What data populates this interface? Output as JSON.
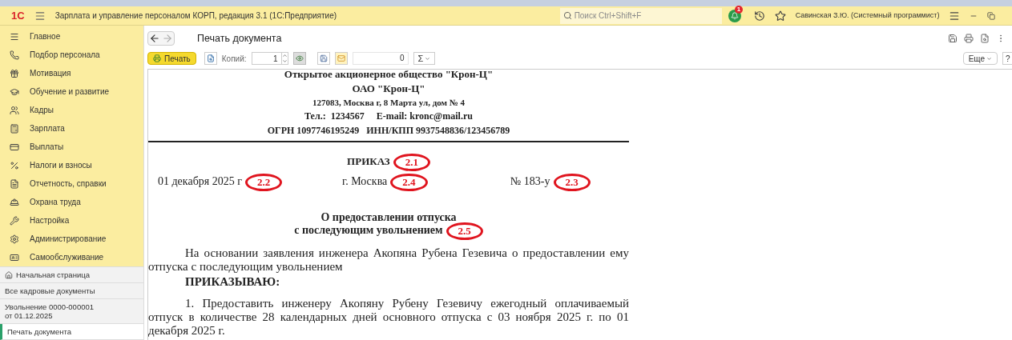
{
  "app_bar": {
    "logo": "1С",
    "title": "Зарплата и управление персоналом КОРП, редакция 3.1  (1С:Предприятие)",
    "search": {
      "placeholder": "Поиск Ctrl+Shift+F"
    },
    "notifications": "1",
    "user": "Савинская З.Ю. (Системный программист)"
  },
  "sections": [
    {
      "label": "Главное"
    },
    {
      "label": "Подбор персонала"
    },
    {
      "label": "Мотивация"
    },
    {
      "label": "Обучение и развитие"
    },
    {
      "label": "Кадры"
    },
    {
      "label": "Зарплата"
    },
    {
      "label": "Выплаты"
    },
    {
      "label": "Налоги и взносы"
    },
    {
      "label": "Отчетность, справки"
    },
    {
      "label": "Охрана труда"
    },
    {
      "label": "Настройка"
    },
    {
      "label": "Администрирование"
    },
    {
      "label": "Самообслуживание"
    }
  ],
  "open_windows": [
    {
      "label": "Начальная страница",
      "selected": false
    },
    {
      "label": "Все кадровые документы",
      "selected": false
    },
    {
      "label": "Увольнение 0000-000001 от 01.12.2025",
      "selected": false
    },
    {
      "label": "Печать документа",
      "selected": true
    }
  ],
  "form": {
    "title": "Печать документа",
    "print_button": "Печать",
    "copies_label": "Копий:",
    "copies": "1",
    "sum": "0",
    "sum_button": "Σ",
    "more_button": "Еще",
    "help_button": "?"
  },
  "document": {
    "header": [
      "Открытое акционерное общество \"Крон-Ц\"",
      "ОАО \"Крон-Ц\"",
      "127083, Москва г, 8 Марта ул, дом № 4",
      "Тел.:  1234567     E-mail: kronc@mail.ru",
      "ОГРН 1097746195249   ИНН/КПП 9937548836/123456789"
    ],
    "title": "ПРИКАЗ",
    "title_mark": "2.1",
    "date": "01 декабря 2025 г",
    "date_mark": "2.2",
    "city": "г. Москва",
    "city_mark": "2.4",
    "number": "№ 183-у",
    "number_mark": "2.3",
    "subject": [
      "О предоставлении отпуска",
      "с последующим увольнением"
    ],
    "subject_mark": "2.5",
    "paragraphs": [
      {
        "kind": "text",
        "text": "На основании заявления инженера Акопяна Рубена Гезевича о предоставлении ему отпуска с последующим увольнением"
      },
      {
        "kind": "heading",
        "text": "ПРИКАЗЫВАЮ:"
      },
      {
        "kind": "text",
        "text": "1. Предоставить инженеру Акопяну Рубену Гезевичу ежегодный оплачиваемый отпуск в количестве 28 календарных дней основного отпуска с 03 ноября 2025 г. по 01 декабря 2025 г."
      }
    ]
  }
}
